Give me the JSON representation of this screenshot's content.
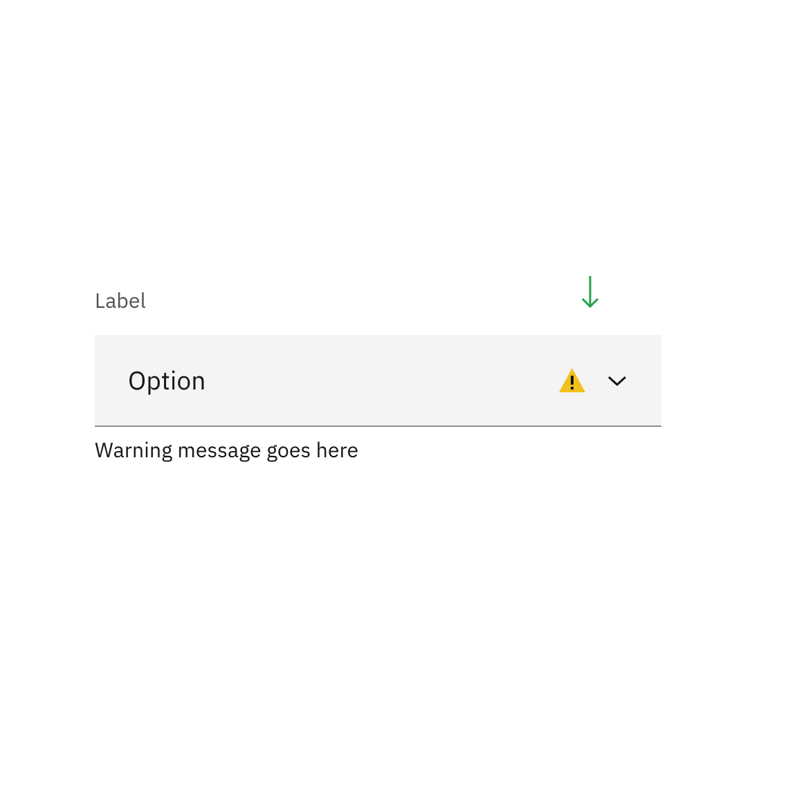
{
  "form": {
    "label": "Label",
    "dropdown": {
      "selected": "Option"
    },
    "helper": "Warning message goes here"
  },
  "colors": {
    "arrow": "#24a148",
    "warning": "#f1c21b",
    "warning_symbol": "#161616"
  }
}
